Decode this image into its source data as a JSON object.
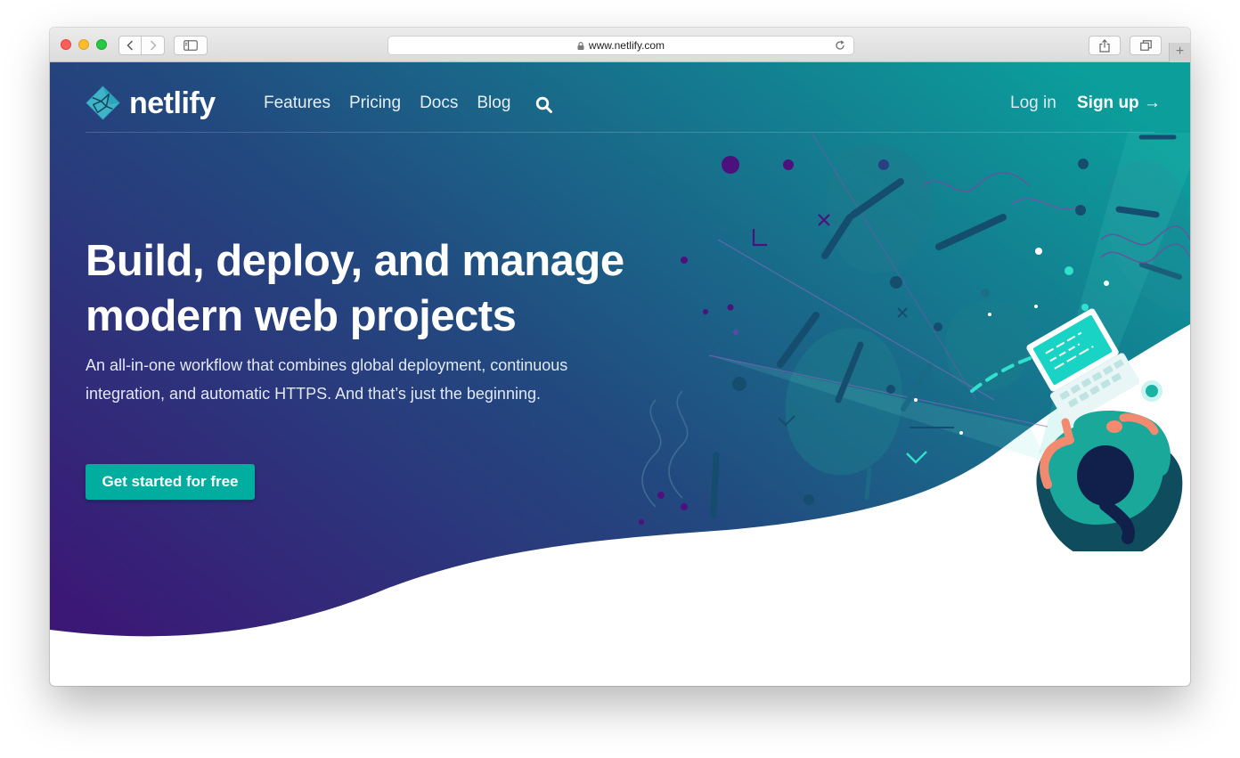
{
  "browser": {
    "url": "www.netlify.com",
    "icons": [
      "back-icon",
      "forward-icon",
      "sidebar-icon",
      "lock-icon",
      "reload-icon",
      "share-icon",
      "tabs-icon",
      "plus-icon"
    ]
  },
  "nav": {
    "logo_text": "netlify",
    "links": [
      "Features",
      "Pricing",
      "Docs",
      "Blog"
    ],
    "login": "Log in",
    "signup": "Sign up →"
  },
  "hero": {
    "headline": "Build, deploy, and manage modern web projects",
    "subtitle": "An all-in-one workflow that combines global deployment, continuous integration, and automatic HTTPS. And that’s just the beginning.",
    "cta": "Get started for free"
  },
  "colors": {
    "gradient_start": "#3b1876",
    "gradient_end": "#0b9e9b",
    "cta": "#00ad9f",
    "accent_teal": "#30e1cd"
  }
}
